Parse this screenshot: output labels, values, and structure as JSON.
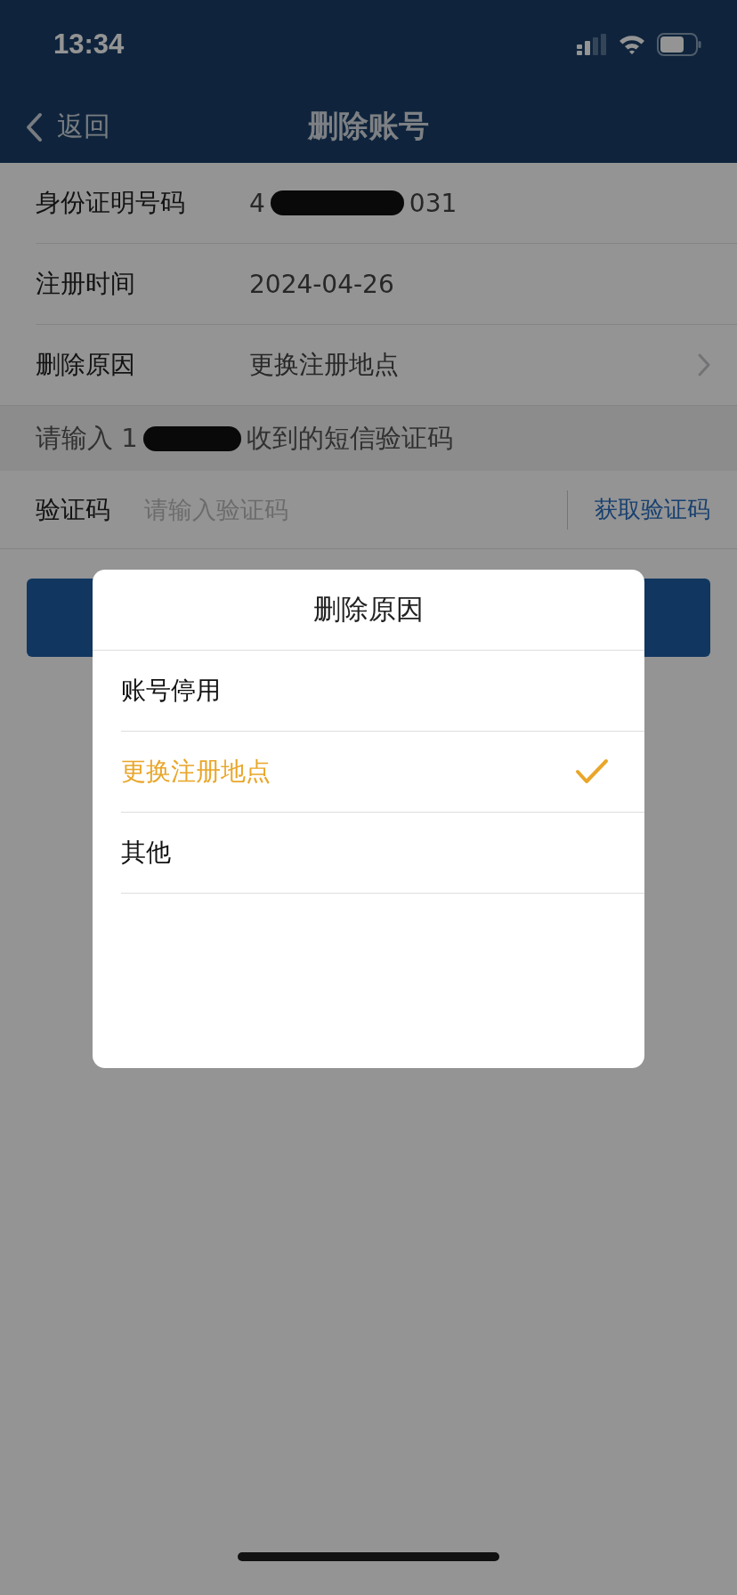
{
  "status_bar": {
    "time": "13:34"
  },
  "nav": {
    "back": "返回",
    "title": "删除账号"
  },
  "rows": [
    {
      "kind": "redacted",
      "label": "身份证明号码",
      "value_start": "4",
      "value_end": "031"
    },
    {
      "kind": "text",
      "label": "注册时间",
      "value": "2024-04-26"
    },
    {
      "kind": "link",
      "label": "删除原因",
      "value": "更换注册地点"
    }
  ],
  "sms_hint": {
    "start": "请输入 1",
    "end": "收到的短信验证码"
  },
  "code_field": {
    "label": "验证码",
    "placeholder": "请输入验证码",
    "action": "获取验证码"
  },
  "dialog": {
    "title": "删除原因",
    "options": [
      {
        "label": "账号停用",
        "selected": false
      },
      {
        "label": "更换注册地点",
        "selected": true
      },
      {
        "label": "其他",
        "selected": false
      }
    ]
  }
}
